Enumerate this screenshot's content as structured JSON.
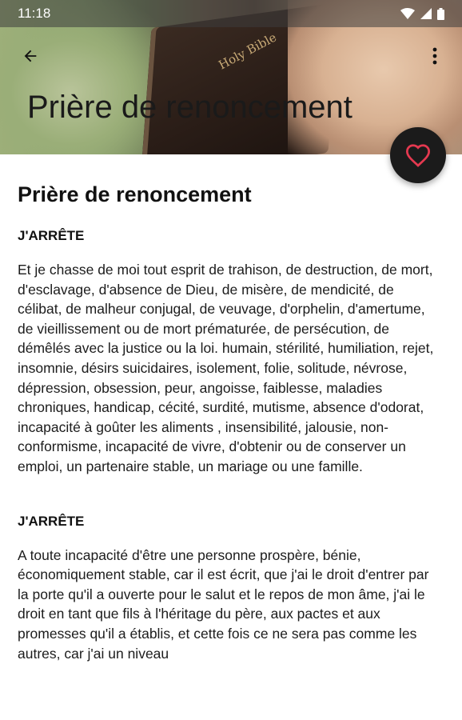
{
  "status": {
    "time": "11:18"
  },
  "app": {
    "collapsing_title": "Prière de renoncement"
  },
  "image": {
    "book_text": "Holy Bible"
  },
  "page": {
    "heading": "Prière de renoncement",
    "sections": [
      {
        "title": "J'ARRÊTE",
        "text": "Et je chasse de moi tout esprit de trahison, de destruction, de mort, d'esclavage, d'absence de Dieu, de misère, de mendicité, de célibat, de malheur conjugal, de veuvage, d'orphelin, d'amertume, de vieillissement ou de mort prématurée, de persécution, de démêlés avec la justice ou la loi. humain, stérilité, humiliation, rejet, insomnie, désirs suicidaires, isolement, folie, solitude, névrose, dépression, obsession, peur, angoisse, faiblesse, maladies chroniques, handicap, cécité, surdité, mutisme, absence d'odorat, incapacité à goûter les aliments , insensibilité, jalousie, non-conformisme, incapacité de vivre, d'obtenir ou de conserver un emploi, un partenaire stable, un mariage ou une famille."
      },
      {
        "title": "J'ARRÊTE",
        "text": "A toute incapacité d'être une personne prospère, bénie, économiquement stable, car il est écrit, que j'ai le droit d'entrer par la porte qu'il a ouverte pour le salut et le repos de mon âme, j'ai le droit en tant que fils à l'héritage du père, aux pactes et aux promesses qu'il a établis, et cette fois ce ne sera pas comme les autres, car j'ai un niveau"
      }
    ]
  },
  "colors": {
    "fab_bg": "#1b1b1b",
    "fab_heart": "#e53950"
  },
  "icons": [
    "wifi-icon",
    "signal-icon",
    "battery-icon",
    "back-arrow-icon",
    "more-vert-icon",
    "heart-icon"
  ]
}
